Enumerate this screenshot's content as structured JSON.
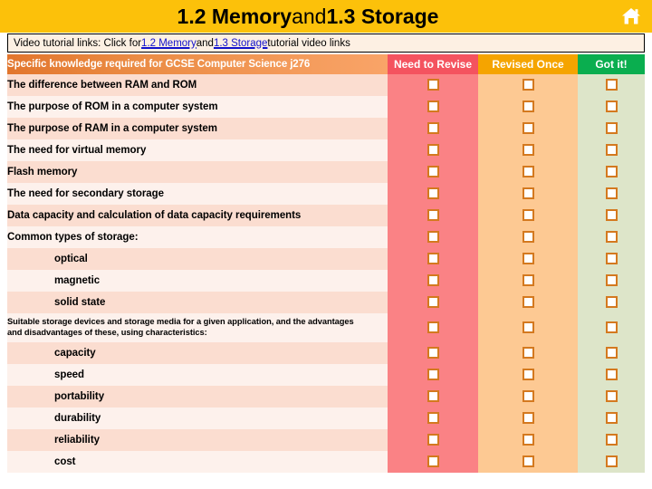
{
  "header": {
    "title_part1": "1.2 Memory",
    "title_mid": " and ",
    "title_part2": "1.3 Storage",
    "home_icon": "home-icon",
    "title_bg": "#fcc10a"
  },
  "video_bar": {
    "prefix": "Video tutorial links: Click for ",
    "link1": "1.2 Memory",
    "between": " and ",
    "link2": "1.3 Storage",
    "suffix": " tutorial video links",
    "link_color": "#1111cc"
  },
  "table": {
    "columns": [
      {
        "label": "Specific knowledge required for GCSE Computer Science j276",
        "color": "#e8813f"
      },
      {
        "label": "Need to Revise",
        "color": "#f4535f",
        "cell_color": "#fa8285"
      },
      {
        "label": "Revised Once",
        "color": "#f5a400",
        "cell_color": "#fdc993"
      },
      {
        "label": "Got it!",
        "color": "#0aae4f",
        "cell_color": "#dde5c9"
      }
    ],
    "checkbox_border_color": "#d4791f",
    "rows": [
      {
        "label": "The difference between RAM and ROM",
        "indent": false,
        "small": false
      },
      {
        "label": "The purpose of ROM in a computer system",
        "indent": false,
        "small": false
      },
      {
        "label": "The purpose of RAM in a computer system",
        "indent": false,
        "small": false
      },
      {
        "label": "The need for virtual memory",
        "indent": false,
        "small": false
      },
      {
        "label": "Flash memory",
        "indent": false,
        "small": false
      },
      {
        "label": "The need for secondary storage",
        "indent": false,
        "small": false
      },
      {
        "label": "Data capacity and calculation of data capacity requirements",
        "indent": false,
        "small": false
      },
      {
        "label": "Common types of storage:",
        "indent": false,
        "small": false
      },
      {
        "label": "optical",
        "indent": true,
        "small": false
      },
      {
        "label": "magnetic",
        "indent": true,
        "small": false
      },
      {
        "label": "solid state",
        "indent": true,
        "small": false
      },
      {
        "label": "Suitable storage devices and storage media for a given application, and the advantages and disadvantages of these, using characteristics:",
        "indent": false,
        "small": true
      },
      {
        "label": "capacity",
        "indent": true,
        "small": false
      },
      {
        "label": "speed",
        "indent": true,
        "small": false
      },
      {
        "label": "portability",
        "indent": true,
        "small": false
      },
      {
        "label": "durability",
        "indent": true,
        "small": false
      },
      {
        "label": "reliability",
        "indent": true,
        "small": false
      },
      {
        "label": "cost",
        "indent": true,
        "small": false
      }
    ]
  }
}
